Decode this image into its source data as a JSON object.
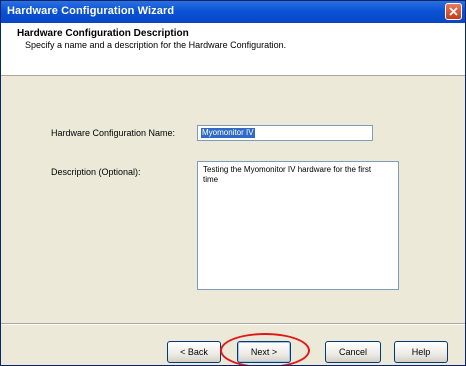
{
  "window": {
    "title": "Hardware Configuration Wizard"
  },
  "header": {
    "title": "Hardware Configuration Description",
    "subtitle": "Specify a name and a description for the Hardware Configuration."
  },
  "form": {
    "name_label": "Hardware Configuration Name:",
    "name_value": "Myomonitor IV",
    "description_label": "Description (Optional):",
    "description_value": "Testing the Myomonitor IV hardware for the first time"
  },
  "buttons": {
    "back": "< Back",
    "next": "Next >",
    "cancel": "Cancel",
    "help": "Help"
  },
  "colors": {
    "title_bar": "#0a53d5",
    "dialog_face": "#ece9d8",
    "highlight_ring": "#e01818"
  },
  "icons": {
    "close": "close-icon"
  }
}
